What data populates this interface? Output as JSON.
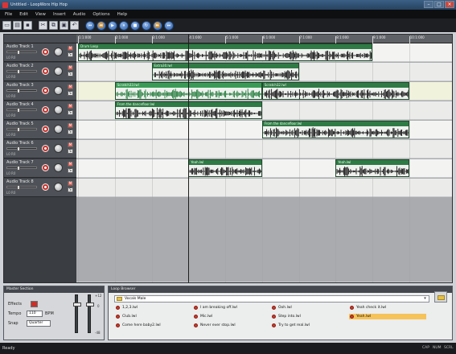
{
  "window": {
    "title": "Untitled - LoopWorx Hip Hop"
  },
  "menu": [
    "File",
    "Edit",
    "View",
    "Insert",
    "Audio",
    "Options",
    "Help"
  ],
  "toolbar": {
    "file_buttons": [
      "new-icon",
      "open-icon",
      "save-icon"
    ],
    "edit_buttons": [
      "cut-icon",
      "copy-icon",
      "paste-icon",
      "undo-icon"
    ],
    "transport_buttons": [
      "rewind-start-icon",
      "rewind-icon",
      "play-icon",
      "pause-icon",
      "stop-icon",
      "loop-icon",
      "fast-forward-icon",
      "forward-end-icon"
    ]
  },
  "timeline": {
    "markers": [
      "1:1:000",
      "2:1:000",
      "3:1:000",
      "4:1:000",
      "5:1:000",
      "6:1:000",
      "7:1:000",
      "8:1:000",
      "9:1:000",
      "10:1:000"
    ]
  },
  "tracks": [
    {
      "name": "Audio Track 1",
      "pan": "L0  R0"
    },
    {
      "name": "Audio Track 2",
      "pan": "L0  R0"
    },
    {
      "name": "Audio Track 3",
      "pan": "L0  R0"
    },
    {
      "name": "Audio Track 4",
      "pan": "L0  R0"
    },
    {
      "name": "Audio Track 5",
      "pan": "L0  R0"
    },
    {
      "name": "Audio Track 6",
      "pan": "L0  R0"
    },
    {
      "name": "Audio Track 7",
      "pan": "L0  R0"
    },
    {
      "name": "Audio Track 8",
      "pan": "L0  R0"
    }
  ],
  "clips": [
    {
      "track": 0,
      "label": "Drum Loop",
      "start": 0,
      "len": 4
    },
    {
      "track": 1,
      "label": "Extra30.lwl",
      "start": 1,
      "len": 2
    },
    {
      "track": 2,
      "label": "Scratch33.lwl",
      "start": 0.5,
      "len": 2
    },
    {
      "track": 2,
      "label": "Scratch32.lwl",
      "start": 2.5,
      "len": 2
    },
    {
      "track": 3,
      "label": "From the dancefloor.lwl",
      "start": 0.5,
      "len": 2
    },
    {
      "track": 4,
      "label": "From the dancefloor.lwl",
      "start": 2.5,
      "len": 2
    },
    {
      "track": 6,
      "label": "Yeah.lwl",
      "start": 1.5,
      "len": 1
    },
    {
      "track": 6,
      "label": "Yeah.lwl",
      "start": 3.5,
      "len": 1
    }
  ],
  "master": {
    "title": "Master Section",
    "effects_label": "Effects",
    "tempo_label": "Tempo",
    "tempo_value": "110",
    "tempo_unit": "BPM",
    "snap_label": "Snap",
    "snap_value": "Quarter",
    "scale_top": "+12",
    "scale_mid": "0",
    "scale_bottom": "-48"
  },
  "loop_browser": {
    "title": "Loop Browser",
    "folder": "Vocals Male",
    "loops": [
      "1,2,3.lwl",
      "I am breaking off.lwl",
      "Ooh.lwl",
      "Yeah check it.lwl",
      "Club.lwl",
      "Mic.lwl",
      "Step into.lwl",
      "Yeah.lwl",
      "Come here baby2.lwl",
      "Never ever stop.lwl",
      "Try to get real.lwl"
    ],
    "selected": "Yeah.lwl"
  },
  "status": {
    "text": "Ready",
    "indicators": [
      "CAP",
      "NUM",
      "SCRL"
    ]
  }
}
